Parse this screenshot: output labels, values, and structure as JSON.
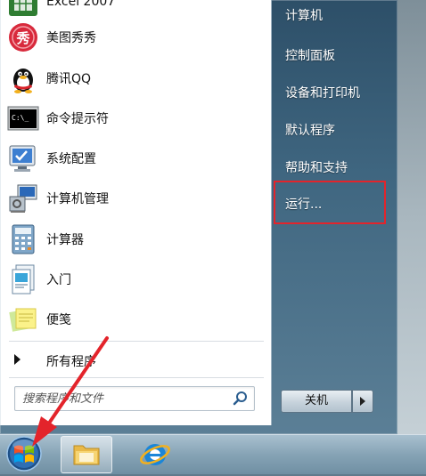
{
  "left_programs": [
    {
      "label": "Excel 2007",
      "icon": "excel-icon"
    },
    {
      "label": "美图秀秀",
      "icon": "meitu-icon"
    },
    {
      "label": "腾讯QQ",
      "icon": "qq-penguin-icon"
    },
    {
      "label": "命令提示符",
      "icon": "command-prompt-icon"
    },
    {
      "label": "系统配置",
      "icon": "system-config-icon"
    },
    {
      "label": "计算机管理",
      "icon": "computer-management-icon"
    },
    {
      "label": "计算器",
      "icon": "calculator-icon"
    },
    {
      "label": "入门",
      "icon": "getting-started-icon"
    },
    {
      "label": "便笺",
      "icon": "sticky-notes-icon"
    }
  ],
  "all_programs_label": "所有程序",
  "search": {
    "placeholder": "搜索程序和文件"
  },
  "right_items": [
    {
      "label": "计算机"
    },
    {
      "label": "控制面板"
    },
    {
      "label": "设备和打印机"
    },
    {
      "label": "默认程序"
    },
    {
      "label": "帮助和支持"
    },
    {
      "label": "运行..."
    }
  ],
  "shutdown_label": "关机",
  "colors": {
    "highlight_border": "#e3242b",
    "arrow": "#e3242b"
  }
}
